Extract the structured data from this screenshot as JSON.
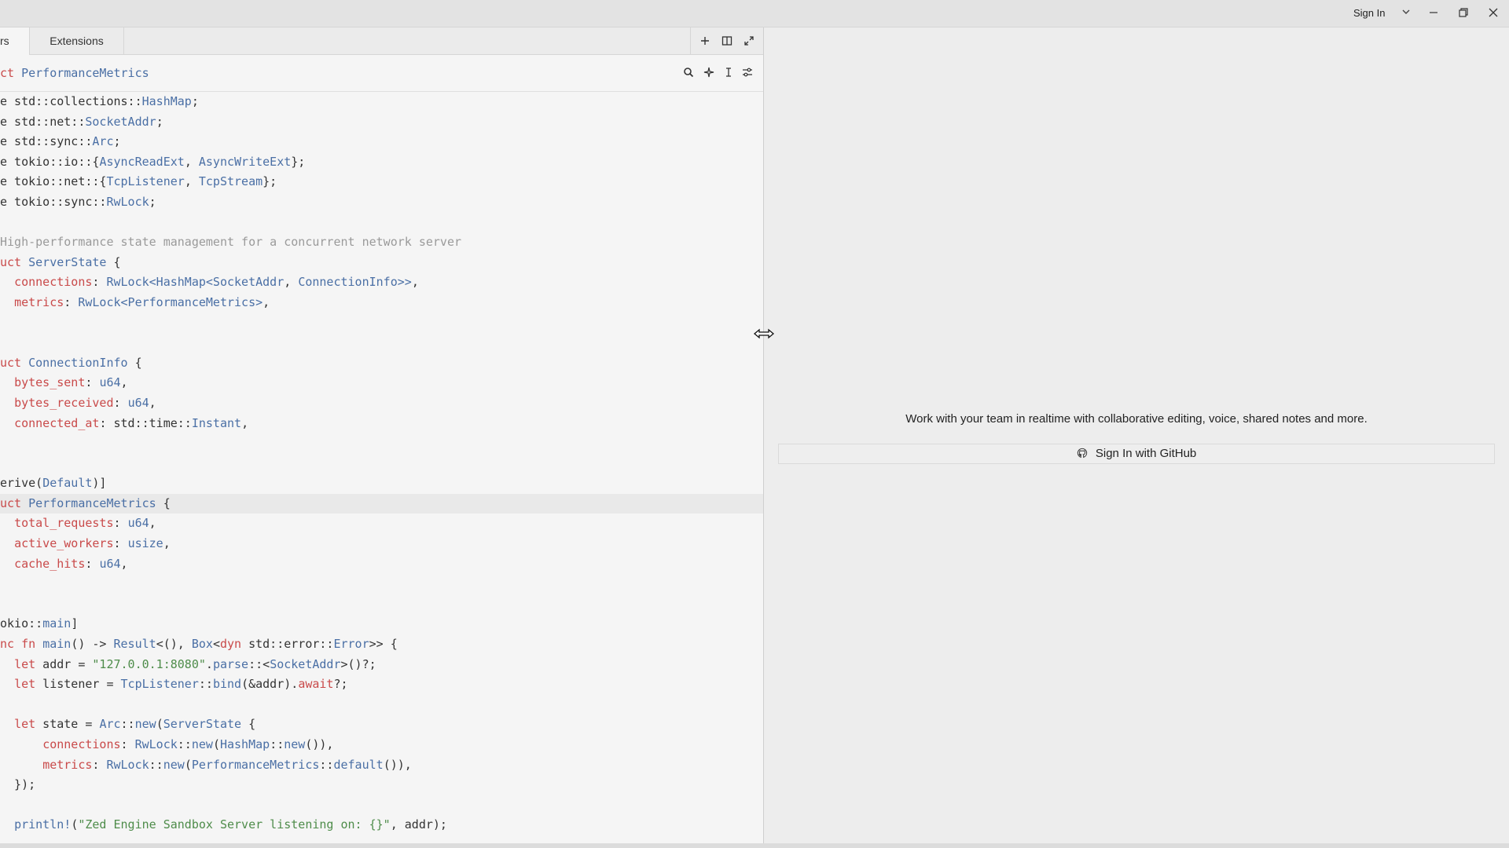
{
  "titlebar": {
    "sign_in_label": "Sign In"
  },
  "tabs": [
    {
      "label": "rs",
      "active": true
    },
    {
      "label": "Extensions",
      "active": false
    }
  ],
  "breadcrumb": {
    "keyword": "ct",
    "name": "PerformanceMetrics"
  },
  "code_lines": [
    [
      [
        "plain",
        "e std::collections::"
      ],
      [
        "ty",
        "HashMap"
      ],
      [
        "plain",
        ";"
      ]
    ],
    [
      [
        "plain",
        "e std::net::"
      ],
      [
        "ty",
        "SocketAddr"
      ],
      [
        "plain",
        ";"
      ]
    ],
    [
      [
        "plain",
        "e std::sync::"
      ],
      [
        "ty",
        "Arc"
      ],
      [
        "plain",
        ";"
      ]
    ],
    [
      [
        "plain",
        "e tokio::io::{"
      ],
      [
        "ty",
        "AsyncReadExt"
      ],
      [
        "plain",
        ", "
      ],
      [
        "ty",
        "AsyncWriteExt"
      ],
      [
        "plain",
        "};"
      ]
    ],
    [
      [
        "plain",
        "e tokio::net::{"
      ],
      [
        "ty",
        "TcpListener"
      ],
      [
        "plain",
        ", "
      ],
      [
        "ty",
        "TcpStream"
      ],
      [
        "plain",
        "};"
      ]
    ],
    [
      [
        "plain",
        "e tokio::sync::"
      ],
      [
        "ty",
        "RwLock"
      ],
      [
        "plain",
        ";"
      ]
    ],
    [
      [
        "plain",
        ""
      ]
    ],
    [
      [
        "cm",
        "High-performance state management for a concurrent network server"
      ]
    ],
    [
      [
        "kw",
        "uct "
      ],
      [
        "ty",
        "ServerState"
      ],
      [
        "plain",
        " {"
      ]
    ],
    [
      [
        "plain",
        "  "
      ],
      [
        "fld",
        "connections"
      ],
      [
        "plain",
        ": "
      ],
      [
        "ty",
        "RwLock<HashMap<SocketAddr"
      ],
      [
        "plain",
        ", "
      ],
      [
        "ty",
        "ConnectionInfo>>"
      ],
      [
        "plain",
        ","
      ]
    ],
    [
      [
        "plain",
        "  "
      ],
      [
        "fld",
        "metrics"
      ],
      [
        "plain",
        ": "
      ],
      [
        "ty",
        "RwLock<PerformanceMetrics>"
      ],
      [
        "plain",
        ","
      ]
    ],
    [
      [
        "plain",
        ""
      ]
    ],
    [
      [
        "plain",
        ""
      ]
    ],
    [
      [
        "kw",
        "uct "
      ],
      [
        "ty",
        "ConnectionInfo"
      ],
      [
        "plain",
        " {"
      ]
    ],
    [
      [
        "plain",
        "  "
      ],
      [
        "fld",
        "bytes_sent"
      ],
      [
        "plain",
        ": "
      ],
      [
        "ty",
        "u64"
      ],
      [
        "plain",
        ","
      ]
    ],
    [
      [
        "plain",
        "  "
      ],
      [
        "fld",
        "bytes_received"
      ],
      [
        "plain",
        ": "
      ],
      [
        "ty",
        "u64"
      ],
      [
        "plain",
        ","
      ]
    ],
    [
      [
        "plain",
        "  "
      ],
      [
        "fld",
        "connected_at"
      ],
      [
        "plain",
        ": std::time::"
      ],
      [
        "ty",
        "Instant"
      ],
      [
        "plain",
        ","
      ]
    ],
    [
      [
        "plain",
        ""
      ]
    ],
    [
      [
        "plain",
        ""
      ]
    ],
    [
      [
        "plain",
        "erive("
      ],
      [
        "ty",
        "Default"
      ],
      [
        "plain",
        ")]"
      ]
    ],
    [
      [
        "kw",
        "uct "
      ],
      [
        "ty",
        "PerformanceMetrics"
      ],
      [
        "plain",
        " {"
      ]
    ],
    [
      [
        "plain",
        "  "
      ],
      [
        "fld",
        "total_requests"
      ],
      [
        "plain",
        ": "
      ],
      [
        "ty",
        "u64"
      ],
      [
        "plain",
        ","
      ]
    ],
    [
      [
        "plain",
        "  "
      ],
      [
        "fld",
        "active_workers"
      ],
      [
        "plain",
        ": "
      ],
      [
        "ty",
        "usize"
      ],
      [
        "plain",
        ","
      ]
    ],
    [
      [
        "plain",
        "  "
      ],
      [
        "fld",
        "cache_hits"
      ],
      [
        "plain",
        ": "
      ],
      [
        "ty",
        "u64"
      ],
      [
        "plain",
        ","
      ]
    ],
    [
      [
        "plain",
        ""
      ]
    ],
    [
      [
        "plain",
        ""
      ]
    ],
    [
      [
        "plain",
        "okio::"
      ],
      [
        "fn",
        "main"
      ],
      [
        "plain",
        "]"
      ]
    ],
    [
      [
        "kw",
        "nc fn "
      ],
      [
        "fn",
        "main"
      ],
      [
        "plain",
        "() -> "
      ],
      [
        "ty",
        "Result"
      ],
      [
        "plain",
        "<(), "
      ],
      [
        "ty",
        "Box"
      ],
      [
        "plain",
        "<"
      ],
      [
        "kw",
        "dyn"
      ],
      [
        "plain",
        " std::error::"
      ],
      [
        "ty",
        "Error"
      ],
      [
        "plain",
        ">> {"
      ]
    ],
    [
      [
        "plain",
        "  "
      ],
      [
        "kw",
        "let"
      ],
      [
        "plain",
        " addr = "
      ],
      [
        "str",
        "\"127.0.0.1:8080\""
      ],
      [
        "plain",
        "."
      ],
      [
        "fn",
        "parse"
      ],
      [
        "plain",
        "::<"
      ],
      [
        "ty",
        "SocketAddr"
      ],
      [
        "plain",
        ">()?;"
      ]
    ],
    [
      [
        "plain",
        "  "
      ],
      [
        "kw",
        "let"
      ],
      [
        "plain",
        " listener = "
      ],
      [
        "ty",
        "TcpListener"
      ],
      [
        "plain",
        "::"
      ],
      [
        "fn",
        "bind"
      ],
      [
        "plain",
        "(&addr)."
      ],
      [
        "kw",
        "await"
      ],
      [
        "plain",
        "?;"
      ]
    ],
    [
      [
        "plain",
        ""
      ]
    ],
    [
      [
        "plain",
        "  "
      ],
      [
        "kw",
        "let"
      ],
      [
        "plain",
        " state = "
      ],
      [
        "ty",
        "Arc"
      ],
      [
        "plain",
        "::"
      ],
      [
        "fn",
        "new"
      ],
      [
        "plain",
        "("
      ],
      [
        "ty",
        "ServerState"
      ],
      [
        "plain",
        " {"
      ]
    ],
    [
      [
        "plain",
        "      "
      ],
      [
        "fld",
        "connections"
      ],
      [
        "plain",
        ": "
      ],
      [
        "ty",
        "RwLock"
      ],
      [
        "plain",
        "::"
      ],
      [
        "fn",
        "new"
      ],
      [
        "plain",
        "("
      ],
      [
        "ty",
        "HashMap"
      ],
      [
        "plain",
        "::"
      ],
      [
        "fn",
        "new"
      ],
      [
        "plain",
        "()),"
      ]
    ],
    [
      [
        "plain",
        "      "
      ],
      [
        "fld",
        "metrics"
      ],
      [
        "plain",
        ": "
      ],
      [
        "ty",
        "RwLock"
      ],
      [
        "plain",
        "::"
      ],
      [
        "fn",
        "new"
      ],
      [
        "plain",
        "("
      ],
      [
        "ty",
        "PerformanceMetrics"
      ],
      [
        "plain",
        "::"
      ],
      [
        "fn",
        "default"
      ],
      [
        "plain",
        "()),"
      ]
    ],
    [
      [
        "plain",
        "  });"
      ]
    ],
    [
      [
        "plain",
        ""
      ]
    ],
    [
      [
        "plain",
        "  "
      ],
      [
        "fn",
        "println!"
      ],
      [
        "plain",
        "("
      ],
      [
        "str",
        "\"Zed Engine Sandbox Server listening on: {}\""
      ],
      [
        "plain",
        ", addr);"
      ]
    ]
  ],
  "highlighted_line": 20,
  "collab": {
    "message": "Work with your team in realtime with collaborative editing, voice, shared notes and more.",
    "github_button": "Sign In with GitHub"
  }
}
